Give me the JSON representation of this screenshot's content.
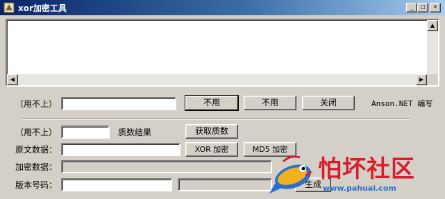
{
  "window": {
    "title": "xor加密工具",
    "controls": {
      "minimize": "_",
      "maximize": "□",
      "close": "×"
    }
  },
  "output_area": {
    "value": ""
  },
  "row1": {
    "label": "（用不上）",
    "input_value": "",
    "button1": "不用",
    "button2": "不用",
    "button3": "关闭",
    "credit": "Anson.NET 编写"
  },
  "row2": {
    "label": "（用不上）",
    "input_value": "",
    "result_label": "质数结果",
    "button": "获取质数"
  },
  "row3": {
    "label": "原文数据：",
    "input_value": "",
    "xor_button": "XOR 加密",
    "md5_button": "MD5 加密"
  },
  "row4": {
    "label": "加密数据：",
    "input_value": ""
  },
  "row5": {
    "label": "版本号码：",
    "input_value": "",
    "second_value": "",
    "button": "生成"
  },
  "watermark": {
    "text": "怕坏社区",
    "url": "www.pahuai.com",
    "colors": {
      "text": "#d81e2c",
      "url": "#2a6fd0",
      "fish": "#f0b020"
    }
  }
}
